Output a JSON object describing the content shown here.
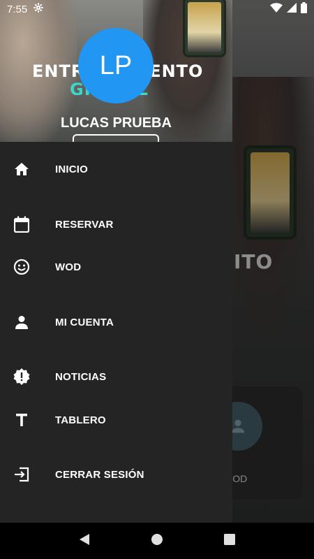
{
  "status_bar": {
    "time": "7:55",
    "settings_icon": "gear-icon",
    "wifi_icon": "wifi-icon",
    "signal_icon": "signal-icon",
    "battery_icon": "battery-icon"
  },
  "drawer": {
    "header": {
      "avatar_initials": "LP",
      "avatar_color": "#2196f3",
      "user_name": "LUCAS PRUEBA",
      "banner_line1": "ENTRENAMIENTO",
      "banner_line2": "GRUPAL"
    },
    "items": [
      {
        "label": "INICIO",
        "icon": "home-icon"
      },
      {
        "label": "RESERVAR",
        "icon": "calendar-icon"
      },
      {
        "label": "WOD",
        "icon": "smiley-icon"
      },
      {
        "label": "MI CUENTA",
        "icon": "person-icon"
      },
      {
        "label": "NOTICIAS",
        "icon": "alert-badge-icon"
      },
      {
        "label": "TABLERO",
        "icon": "text-t-icon"
      },
      {
        "label": "CERRAR SESIÓN",
        "icon": "logout-icon"
      }
    ]
  },
  "background": {
    "card_label": "WOD",
    "text_fragment": "ITO"
  },
  "nav_bar": {
    "back_icon": "back-triangle-icon",
    "home_icon": "home-circle-icon",
    "recents_icon": "recents-square-icon"
  }
}
